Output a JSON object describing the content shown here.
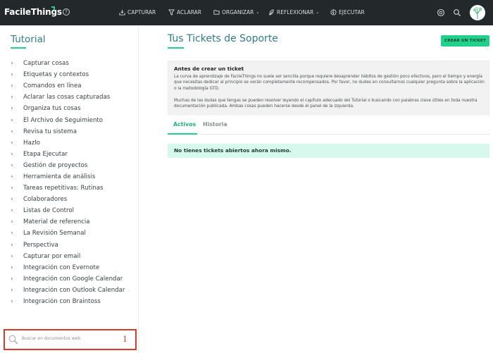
{
  "app": {
    "logo": "FacileThings"
  },
  "nav": {
    "items": [
      {
        "label": "CAPTURAR",
        "icon": "inbox-tray-icon"
      },
      {
        "label": "ACLARAR",
        "icon": "funnel-icon"
      },
      {
        "label": "ORGANIZAR",
        "icon": "folder-icon"
      },
      {
        "label": "REFLEXIONAR",
        "icon": "leaf-icon"
      },
      {
        "label": "EJECUTAR",
        "icon": "bolt-icon"
      }
    ],
    "right_icons": [
      "target-icon",
      "search-icon",
      "avatar"
    ]
  },
  "sidebar": {
    "title": "Tutorial",
    "items": [
      "Capturar cosas",
      "Etiquetas y contextos",
      "Comandos en línea",
      "Aclarar las cosas capturadas",
      "Organiza tus cosas",
      "El Archivo de Seguimiento",
      "Revisa tu sistema",
      "Hazlo",
      "Etapa Ejecutar",
      "Gestión de proyectos",
      "Herramienta de análisis",
      "Tareas repetitivas: Rutinas",
      "Colaboradores",
      "Listas de Control",
      "Material de referencia",
      "La Revisión Semanal",
      "Perspectiva",
      "Capturar por email",
      "Integración con Evernote",
      "Integración con Google Calendar",
      "Integración con Outlook Calendar",
      "Integración con Braintoss"
    ],
    "search": {
      "placeholder": "Buscar en documentos web",
      "annotation": "1"
    }
  },
  "main": {
    "title": "Tus Tickets de Soporte",
    "create_button": "CREAR UN TICKET",
    "notice_panel": {
      "title": "Antes de crear un ticket",
      "paragraph1": "La curva de aprendizaje de FacileThings no suele ser sencilla porque requiere desaprender hábitos de gestión poco efectivos, pero el tiempo y energía que necesitas dedicar al principio se verán completamente recompensados. Por favor, no dudes en consultarnos cualquier pregunta sobre la aplicación o la metodología GTD.",
      "paragraph2": "Muchas de las dudas que tengas se pueden resolver leyendo el capítulo adecuado del Tutorial o buscando con palabras clave útiles en toda nuestra documentación publicada. Ambas cosas pueden hacerse desde el panel de la izquierda."
    },
    "tabs": [
      {
        "label": "Activos",
        "active": true
      },
      {
        "label": "Historia",
        "active": false
      }
    ],
    "empty_message": "No tienes tickets abiertos ahora mismo."
  },
  "colors": {
    "topbar": "#23292b",
    "accent_green": "#1fd18a",
    "title_teal": "#2f7d8a",
    "notice_bg": "#d7f8ec",
    "annotation_red": "#d93b2b"
  }
}
